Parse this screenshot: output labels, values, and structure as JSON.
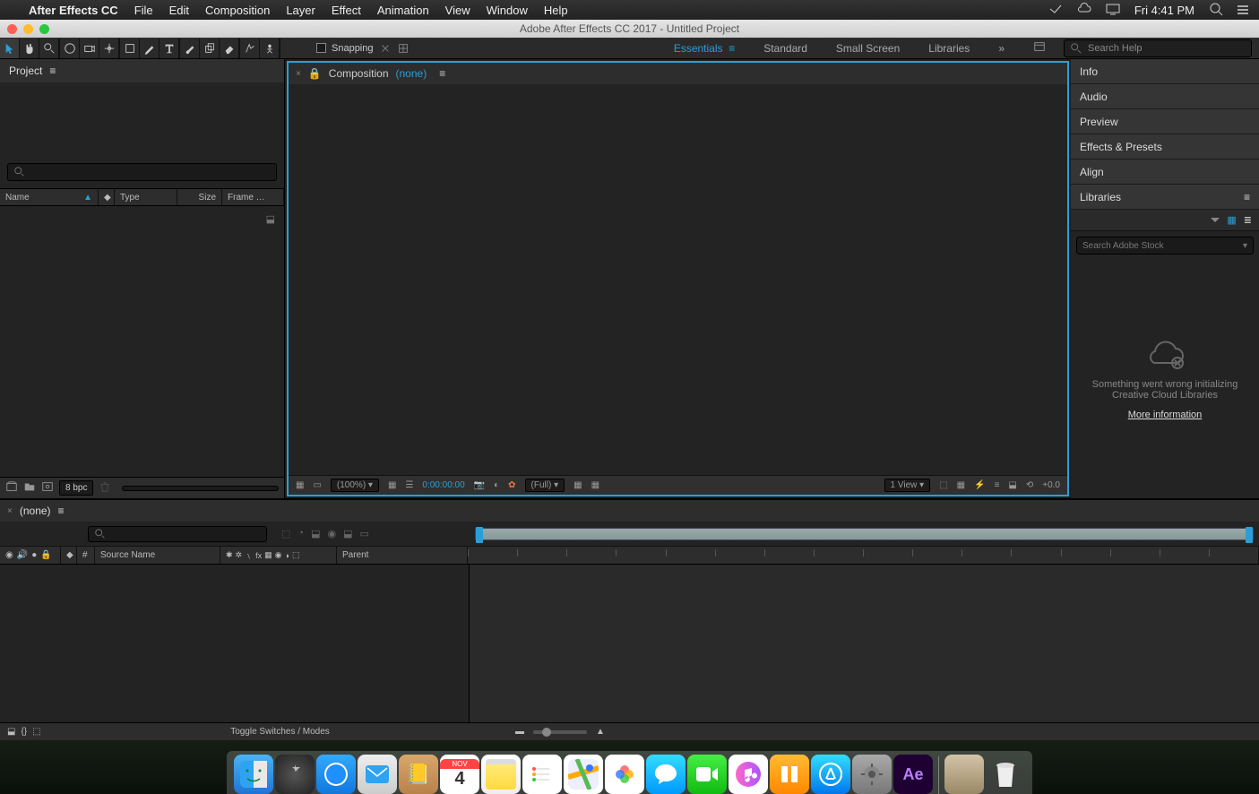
{
  "menubar": {
    "app": "After Effects CC",
    "items": [
      "File",
      "Edit",
      "Composition",
      "Layer",
      "Effect",
      "Animation",
      "View",
      "Window",
      "Help"
    ],
    "clock": "Fri 4:41 PM"
  },
  "window": {
    "title": "Adobe After Effects CC 2017 - Untitled Project"
  },
  "toolbar": {
    "snapping": "Snapping",
    "workspaces": [
      "Essentials",
      "Standard",
      "Small Screen",
      "Libraries"
    ],
    "active_ws": "Essentials",
    "search_placeholder": "Search Help"
  },
  "project": {
    "tab": "Project",
    "cols": {
      "name": "Name",
      "type": "Type",
      "size": "Size",
      "frame": "Frame …"
    },
    "footer_bpc": "8 bpc"
  },
  "comp": {
    "tab_label": "Composition",
    "tab_none": "(none)",
    "zoom": "(100%)",
    "time": "0:00:00:00",
    "res": "(Full)",
    "view": "1 View",
    "exposure": "+0.0"
  },
  "right": {
    "panels": [
      "Info",
      "Audio",
      "Preview",
      "Effects & Presets",
      "Align",
      "Libraries"
    ],
    "stock_placeholder": "Search Adobe Stock",
    "error": "Something went wrong initializing Creative Cloud Libraries",
    "more": "More information"
  },
  "timeline": {
    "tab": "(none)",
    "cols": {
      "num": "#",
      "source": "Source Name",
      "parent": "Parent"
    },
    "toggle": "Toggle Switches / Modes"
  },
  "dock": {
    "items": [
      "finder",
      "launchpad",
      "safari",
      "mail",
      "contacts",
      "calendar",
      "notes",
      "reminders",
      "photos-app",
      "photos",
      "messages",
      "facetime",
      "itunes",
      "ibooks",
      "appstore",
      "settings",
      "after-effects"
    ],
    "cal": {
      "month": "NOV",
      "day": "4"
    }
  }
}
